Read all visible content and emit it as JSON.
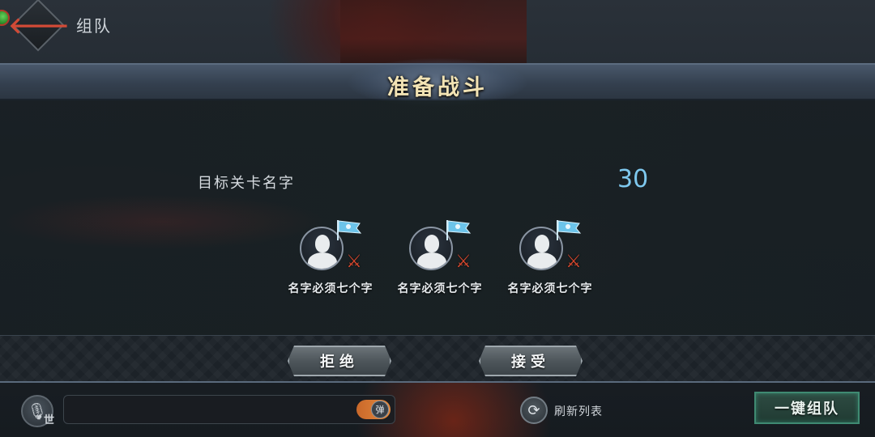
{
  "header": {
    "title": "组队"
  },
  "panel": {
    "title": "准备战斗",
    "stage_name": "目标关卡名字",
    "countdown": "30"
  },
  "members": [
    {
      "name": "名字必须七个字"
    },
    {
      "name": "名字必须七个字"
    },
    {
      "name": "名字必须七个字"
    }
  ],
  "actions": {
    "reject_label": "拒绝",
    "accept_label": "接受"
  },
  "bottom_bar": {
    "channel_tag": "世",
    "danmaku_label": "弹",
    "refresh_label": "刷新列表",
    "quick_team_label": "一键组队"
  },
  "colors": {
    "countdown": "#7ec8ee",
    "title_gold": "#f2e3b4",
    "sword_red": "#d9492f",
    "flag_blue": "#6cc4ea",
    "quick_team_green": "#3f8a72",
    "toggle_orange": "#e68a3d"
  },
  "icons": {
    "back": "back-arrow-icon",
    "flag": "team-flag-icon",
    "swords": "crossed-swords-icon",
    "voice": "microphone-icon",
    "refresh": "refresh-icon"
  }
}
